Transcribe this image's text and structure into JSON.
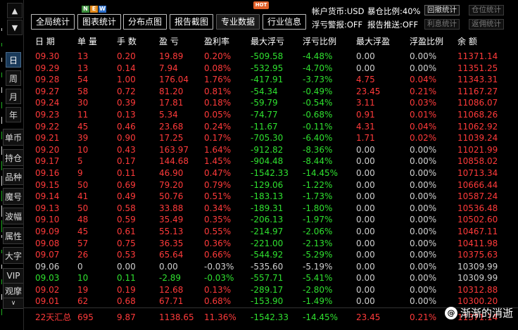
{
  "sidebar": {
    "up_arrow": "▲",
    "down_arrow": "▼",
    "period_buttons": [
      "日",
      "周",
      "月",
      "年"
    ],
    "tool_buttons": [
      "单币",
      "持仓",
      "品种",
      "魔号",
      "波幅",
      "属性",
      "大字",
      "VIP",
      "观摩"
    ],
    "collapse_arrow": "∨"
  },
  "toolbar": {
    "buttons": [
      "全局统计",
      "图表统计",
      "分布点图",
      "报告截图",
      "专业数据",
      "行业信息"
    ],
    "badge_new": [
      "N",
      "E",
      "W"
    ],
    "badge_hot": "HOT",
    "account_currency": "帐户货币:USD",
    "exposure_ratio": "暴仓比例:40%",
    "float_alert": "浮亏警报:OFF",
    "report_push": "报告推送:OFF",
    "mini_buttons": [
      "回撤统计",
      "仓位统计",
      "利息统计",
      "返佣统计"
    ]
  },
  "table": {
    "headers": [
      "日 期",
      "单 量",
      "手 数",
      "盈 亏",
      "盈利率",
      "最大浮亏",
      "浮亏比例",
      "最大浮盈",
      "浮盈比例",
      "余 额"
    ],
    "rows": [
      [
        "09.30",
        "13",
        "0.20",
        "19.89",
        "0.20%",
        "-509.58",
        "-4.48%",
        "0.00",
        "0.00%",
        "11371.14"
      ],
      [
        "09.29",
        "13",
        "0.14",
        "7.94",
        "0.08%",
        "-532.95",
        "-4.70%",
        "0.00",
        "0.00%",
        "11351.25"
      ],
      [
        "09.28",
        "54",
        "1.00",
        "176.04",
        "1.76%",
        "-417.91",
        "-3.73%",
        "4.75",
        "0.04%",
        "11343.31"
      ],
      [
        "09.27",
        "58",
        "0.72",
        "81.20",
        "0.81%",
        "-54.34",
        "-0.49%",
        "23.45",
        "0.21%",
        "11167.27"
      ],
      [
        "09.24",
        "30",
        "0.39",
        "17.81",
        "0.18%",
        "-59.79",
        "-0.54%",
        "3.11",
        "0.03%",
        "11086.07"
      ],
      [
        "09.23",
        "11",
        "0.13",
        "5.34",
        "0.05%",
        "-74.77",
        "-0.68%",
        "0.91",
        "0.01%",
        "11068.26"
      ],
      [
        "09.22",
        "45",
        "0.46",
        "23.68",
        "0.24%",
        "-11.67",
        "-0.11%",
        "4.31",
        "0.04%",
        "11062.92"
      ],
      [
        "09.21",
        "39",
        "0.90",
        "17.25",
        "0.17%",
        "-705.30",
        "-6.40%",
        "1.71",
        "0.02%",
        "11039.24"
      ],
      [
        "09.20",
        "10",
        "0.43",
        "163.97",
        "1.64%",
        "-912.82",
        "-8.36%",
        "0.00",
        "0.00%",
        "11021.99"
      ],
      [
        "09.17",
        "5",
        "0.17",
        "144.68",
        "1.45%",
        "-904.48",
        "-8.44%",
        "0.00",
        "0.00%",
        "10858.02"
      ],
      [
        "09.16",
        "9",
        "0.11",
        "46.90",
        "0.47%",
        "-1542.33",
        "-14.45%",
        "0.00",
        "0.00%",
        "10713.34"
      ],
      [
        "09.15",
        "50",
        "0.69",
        "79.20",
        "0.79%",
        "-129.06",
        "-1.22%",
        "0.00",
        "0.00%",
        "10666.44"
      ],
      [
        "09.14",
        "41",
        "0.49",
        "50.76",
        "0.51%",
        "-183.13",
        "-1.73%",
        "0.00",
        "0.00%",
        "10587.24"
      ],
      [
        "09.13",
        "50",
        "0.58",
        "33.88",
        "0.34%",
        "-189.31",
        "-1.80%",
        "0.00",
        "0.00%",
        "10536.48"
      ],
      [
        "09.10",
        "48",
        "0.59",
        "35.49",
        "0.35%",
        "-206.13",
        "-1.97%",
        "0.00",
        "0.00%",
        "10502.60"
      ],
      [
        "09.09",
        "45",
        "0.61",
        "55.13",
        "0.55%",
        "-214.97",
        "-2.06%",
        "0.00",
        "0.00%",
        "10467.11"
      ],
      [
        "09.08",
        "57",
        "0.75",
        "36.35",
        "0.36%",
        "-221.00",
        "-2.13%",
        "0.00",
        "0.00%",
        "10411.98"
      ],
      [
        "09.07",
        "26",
        "0.53",
        "65.64",
        "0.66%",
        "-544.92",
        "-5.29%",
        "0.00",
        "0.00%",
        "10375.63"
      ],
      [
        "09.06",
        "0",
        "0.00",
        "0.00",
        "-0.03%",
        "-535.60",
        "-5.19%",
        "0.00",
        "0.00%",
        "10309.99"
      ],
      [
        "09.03",
        "10",
        "0.11",
        "-2.89",
        "-0.03%",
        "-557.71",
        "-5.41%",
        "0.00",
        "0.00%",
        "10309.99"
      ],
      [
        "09.02",
        "19",
        "0.19",
        "12.68",
        "0.13%",
        "-289.17",
        "-2.80%",
        "0.00",
        "0.00%",
        "10312.88"
      ],
      [
        "09.01",
        "62",
        "0.68",
        "67.71",
        "0.68%",
        "-153.90",
        "-1.49%",
        "0.00",
        "0.00%",
        "10300.20"
      ]
    ],
    "row_colors": [
      "red",
      "red",
      "red",
      "red",
      "red",
      "red",
      "red",
      "red",
      "red",
      "red",
      "red",
      "red",
      "red",
      "red",
      "red",
      "red",
      "red",
      "red",
      "wht",
      "grn",
      "red",
      "red"
    ],
    "summary": [
      "22天汇总",
      "695",
      "9.87",
      "1138.65",
      "11.36%",
      "-1542.33",
      "-14.45%",
      "23.45",
      "0.21%",
      "11371.14"
    ]
  },
  "watermark": {
    "logo": "@",
    "text": "渐渐的消逝"
  },
  "colors": {
    "profit": "#ff3a3a",
    "loss": "#2fe02f",
    "neutral": "#cfcfcf",
    "header": "#ffffff",
    "background": "#000000"
  }
}
